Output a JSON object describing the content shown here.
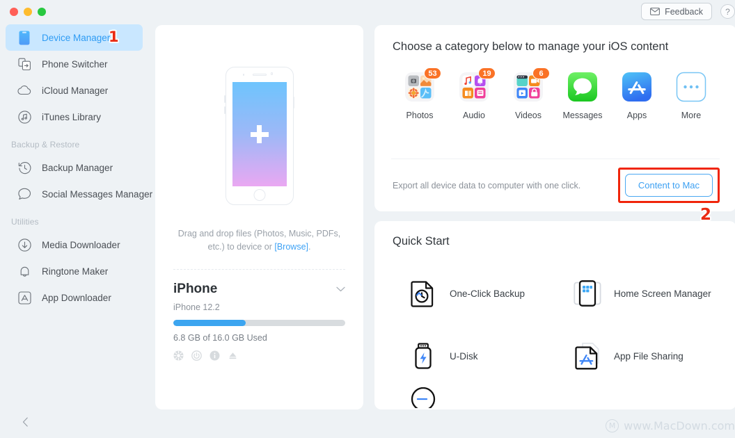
{
  "window": {
    "traffic_lights": [
      "close",
      "minimize",
      "maximize"
    ]
  },
  "topbar": {
    "feedback_label": "Feedback",
    "help_label": "?"
  },
  "sidebar": {
    "items": [
      {
        "label": "Device Manager",
        "icon": "phone-icon",
        "active": true,
        "marker": "1"
      },
      {
        "label": "Phone Switcher",
        "icon": "switch-icon",
        "active": false
      },
      {
        "label": "iCloud Manager",
        "icon": "cloud-icon",
        "active": false
      },
      {
        "label": "iTunes Library",
        "icon": "music-note-icon",
        "active": false
      }
    ],
    "group_backup_label": "Backup & Restore",
    "backup_items": [
      {
        "label": "Backup Manager",
        "icon": "history-clock-icon"
      },
      {
        "label": "Social Messages Manager",
        "icon": "chat-bubble-icon"
      }
    ],
    "group_utilities_label": "Utilities",
    "utility_items": [
      {
        "label": "Media Downloader",
        "icon": "download-circle-icon"
      },
      {
        "label": "Ringtone Maker",
        "icon": "bell-icon"
      },
      {
        "label": "App Downloader",
        "icon": "appstore-square-icon"
      }
    ],
    "collapse_icon": "chevron-left-icon"
  },
  "device": {
    "drop_text_line1": "Drag and drop files (Photos, Music, PDFs,",
    "drop_text_line2_pre": "etc.) to device or ",
    "browse_label": "[Browse]",
    "drop_text_line2_post": ".",
    "name": "iPhone",
    "version": "iPhone 12.2",
    "storage_used_label": "6.8 GB of  16.0 GB Used",
    "storage_percent": 42,
    "actions": [
      "refresh-icon",
      "power-icon",
      "info-icon",
      "eject-icon"
    ],
    "chevron_icon": "chevron-down-icon",
    "screen_plus_icon": "plus-icon"
  },
  "categories": {
    "title": "Choose a category below to manage your iOS content",
    "items": [
      {
        "label": "Photos",
        "count": "53",
        "icon": "photos-folder-icon"
      },
      {
        "label": "Audio",
        "count": "19",
        "icon": "audio-folder-icon"
      },
      {
        "label": "Videos",
        "count": "6",
        "icon": "videos-folder-icon"
      },
      {
        "label": "Messages",
        "count": null,
        "icon": "messages-icon"
      },
      {
        "label": "Apps",
        "count": null,
        "icon": "appstore-icon"
      },
      {
        "label": "More",
        "count": null,
        "icon": "more-dots-icon"
      }
    ],
    "export_text": "Export all device data to computer with one click.",
    "content_to_mac_label": "Content to Mac",
    "marker": "2"
  },
  "quick_start": {
    "title": "Quick Start",
    "items": [
      {
        "label": "One-Click Backup",
        "icon": "backup-file-icon"
      },
      {
        "label": "Home Screen Manager",
        "icon": "home-screen-icon"
      },
      {
        "label": "U-Disk",
        "icon": "usb-drive-icon"
      },
      {
        "label": "App File Sharing",
        "icon": "app-file-icon"
      }
    ]
  },
  "watermark": {
    "text": "www.MacDown.com",
    "logo_letter": "M"
  },
  "colors": {
    "accent": "#3ca0f2",
    "badge_orange": "#fa7226",
    "marker_red": "#ea2a12",
    "sidebar_active_bg": "#c9e7ff",
    "background": "#eef2f5"
  }
}
